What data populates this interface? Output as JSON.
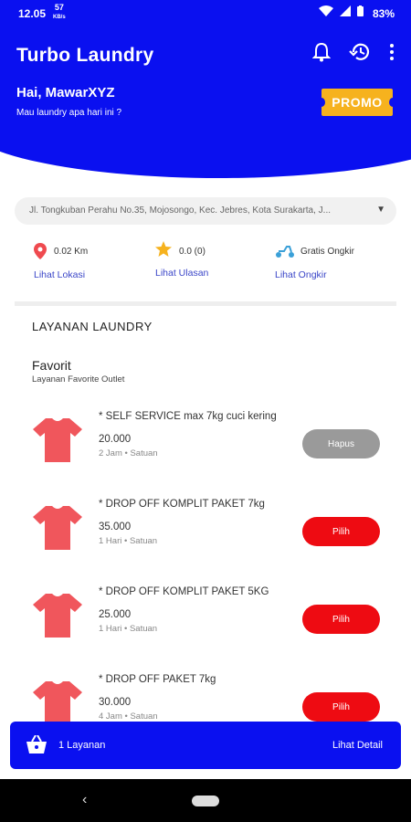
{
  "status": {
    "time": "12.05",
    "net_speed": "57",
    "net_unit": "KB/s",
    "battery": "83%"
  },
  "header": {
    "title": "Turbo Laundry",
    "greeting": "Hai, MawarXYZ",
    "subtitle": "Mau laundry apa hari ini ?",
    "promo": "PROMO"
  },
  "address": "Jl. Tongkuban Perahu No.35, Mojosongo, Kec. Jebres, Kota Surakarta, J...",
  "info": [
    {
      "value": "0.02 Km",
      "link": "Lihat Lokasi",
      "icon": "location-pin-icon"
    },
    {
      "value": "0.0 (0)",
      "link": "Lihat Ulasan",
      "icon": "star-icon"
    },
    {
      "value": "Gratis Ongkir",
      "link": "Lihat Ongkir",
      "icon": "scooter-icon"
    }
  ],
  "section_title": "LAYANAN LAUNDRY",
  "favorite": {
    "title": "Favorit",
    "subtitle": "Layanan Favorite Outlet"
  },
  "items": [
    {
      "name": "* SELF SERVICE max 7kg cuci kering",
      "price": "20.000",
      "meta": "2 Jam • Satuan",
      "button": "Hapus"
    },
    {
      "name": "* DROP OFF KOMPLIT PAKET 7kg",
      "price": "35.000",
      "meta": "1 Hari • Satuan",
      "button": "Pilih"
    },
    {
      "name": "* DROP OFF KOMPLIT PAKET 5KG",
      "price": "25.000",
      "meta": "1 Hari • Satuan",
      "button": "Pilih"
    },
    {
      "name": "* DROP OFF PAKET 7kg",
      "price": "30.000",
      "meta": "4 Jam • Satuan",
      "button": "Pilih"
    }
  ],
  "cart": {
    "count": "1 Layanan",
    "detail": "Lihat Detail"
  },
  "colors": {
    "primary": "#0a10f0",
    "accent": "#ee0b12",
    "promo": "#f6b21e",
    "shirt": "#f0565c"
  }
}
